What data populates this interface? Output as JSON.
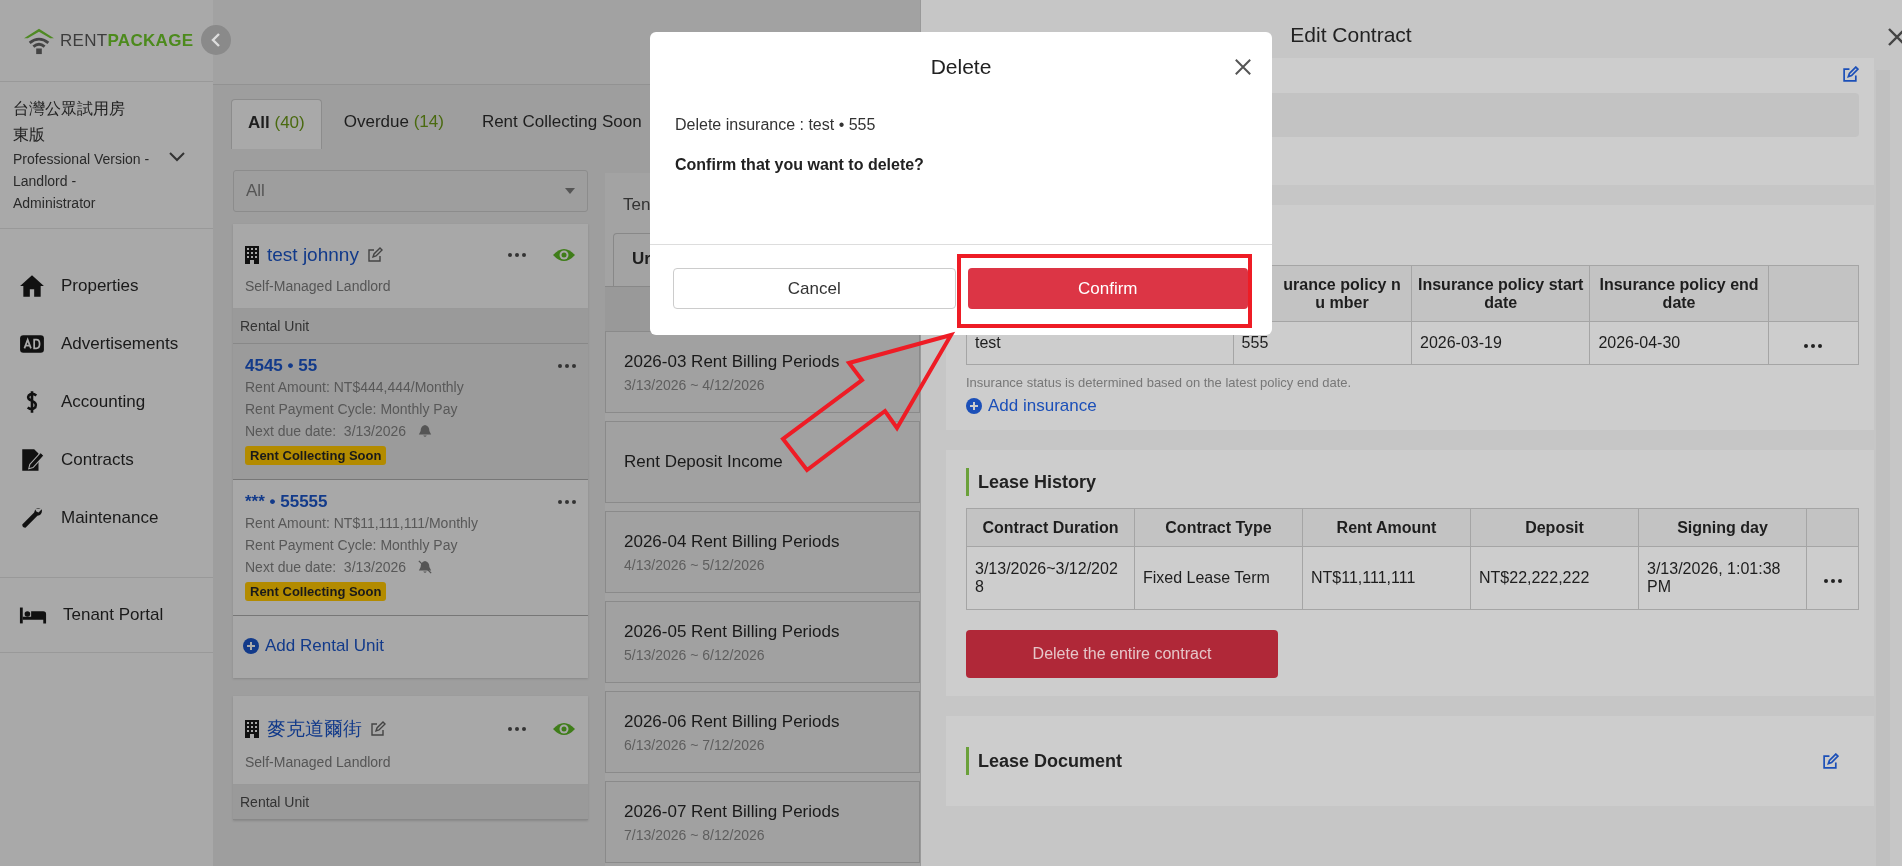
{
  "sidebar": {
    "logo": {
      "word1": "RENT",
      "word2": "PACKAGE"
    },
    "org_name": "台灣公眾試用房東版",
    "plan": "Professional Version - Landlord - Administrator",
    "nav": [
      {
        "label": "Properties"
      },
      {
        "label": "Advertisements"
      },
      {
        "label": "Accounting"
      },
      {
        "label": "Contracts"
      },
      {
        "label": "Maintenance"
      }
    ],
    "footer_nav": [
      {
        "label": "Tenant Portal"
      }
    ]
  },
  "tabs": [
    {
      "label": "All",
      "count": "(40)",
      "selected": true
    },
    {
      "label": "Overdue",
      "count": "(14)",
      "selected": false
    },
    {
      "label": "Rent Collecting Soon",
      "selected": false
    }
  ],
  "filter": {
    "value": "All"
  },
  "properties": [
    {
      "name": "test johnny",
      "type": "Self-Managed Landlord",
      "units_heading": "Rental Unit",
      "add_unit": "Add Rental Unit",
      "units": [
        {
          "unit": "4545 • 55",
          "rent": "Rent Amount: NT$444,444/Monthly",
          "cycle": "Rent Payment Cycle: Monthly Pay",
          "due_label": "Next due date:",
          "due": "3/13/2026",
          "reminder": true,
          "badge": "Rent Collecting Soon",
          "selected": true
        },
        {
          "unit": "*** • 55555",
          "rent": "Rent Amount: NT$11,111,111/Monthly",
          "cycle": "Rent Payment Cycle: Monthly Pay",
          "due_label": "Next due date:",
          "due": "3/13/2026",
          "reminder": false,
          "badge": "Rent Collecting Soon",
          "selected": false
        }
      ]
    },
    {
      "name": "麥克道爾街",
      "type": "Self-Managed Landlord",
      "units_heading": "Rental Unit"
    }
  ],
  "ledger": {
    "tab": "Ten",
    "subtab": "Ur",
    "items": [
      {
        "title": "2026-03 Rent Billing Periods",
        "dates": "3/13/2026 ~ 4/12/2026"
      },
      {
        "title": "Rent Deposit Income"
      },
      {
        "title": "2026-04 Rent Billing Periods",
        "dates": "4/13/2026 ~ 5/12/2026"
      },
      {
        "title": "2026-05 Rent Billing Periods",
        "dates": "5/13/2026 ~ 6/12/2026"
      },
      {
        "title": "2026-06 Rent Billing Periods",
        "dates": "6/13/2026 ~ 7/12/2026"
      },
      {
        "title": "2026-07 Rent Billing Periods",
        "dates": "7/13/2026 ~ 8/12/2026"
      }
    ]
  },
  "edit_contract": {
    "title": "Edit Contract",
    "insurance": {
      "columns": [
        "",
        "urance policy nu mber",
        "Insurance policy start date",
        "Insurance policy end date"
      ],
      "rows": [
        [
          "test",
          "555",
          "2026-03-19",
          "2026-04-30"
        ]
      ],
      "note": "Insurance status is determined based on the latest policy end date.",
      "add_label": "Add insurance"
    },
    "lease_history": {
      "title": "Lease History",
      "columns": [
        "Contract Duration",
        "Contract Type",
        "Rent Amount",
        "Deposit",
        "Signing day"
      ],
      "rows": [
        [
          "3/13/2026~3/12/2028",
          "Fixed Lease Term",
          "NT$11,111,111",
          "NT$22,222,222",
          "3/13/2026, 1:01:38 PM"
        ]
      ],
      "delete_button": "Delete the entire contract"
    },
    "lease_document": {
      "title": "Lease Document"
    }
  },
  "dialog": {
    "title": "Delete",
    "message": "Delete insurance : test • 555",
    "question": "Confirm that you want to delete?",
    "cancel": "Cancel",
    "confirm": "Confirm"
  },
  "annotation": {
    "highlight_confirm": true,
    "arrow": true
  }
}
